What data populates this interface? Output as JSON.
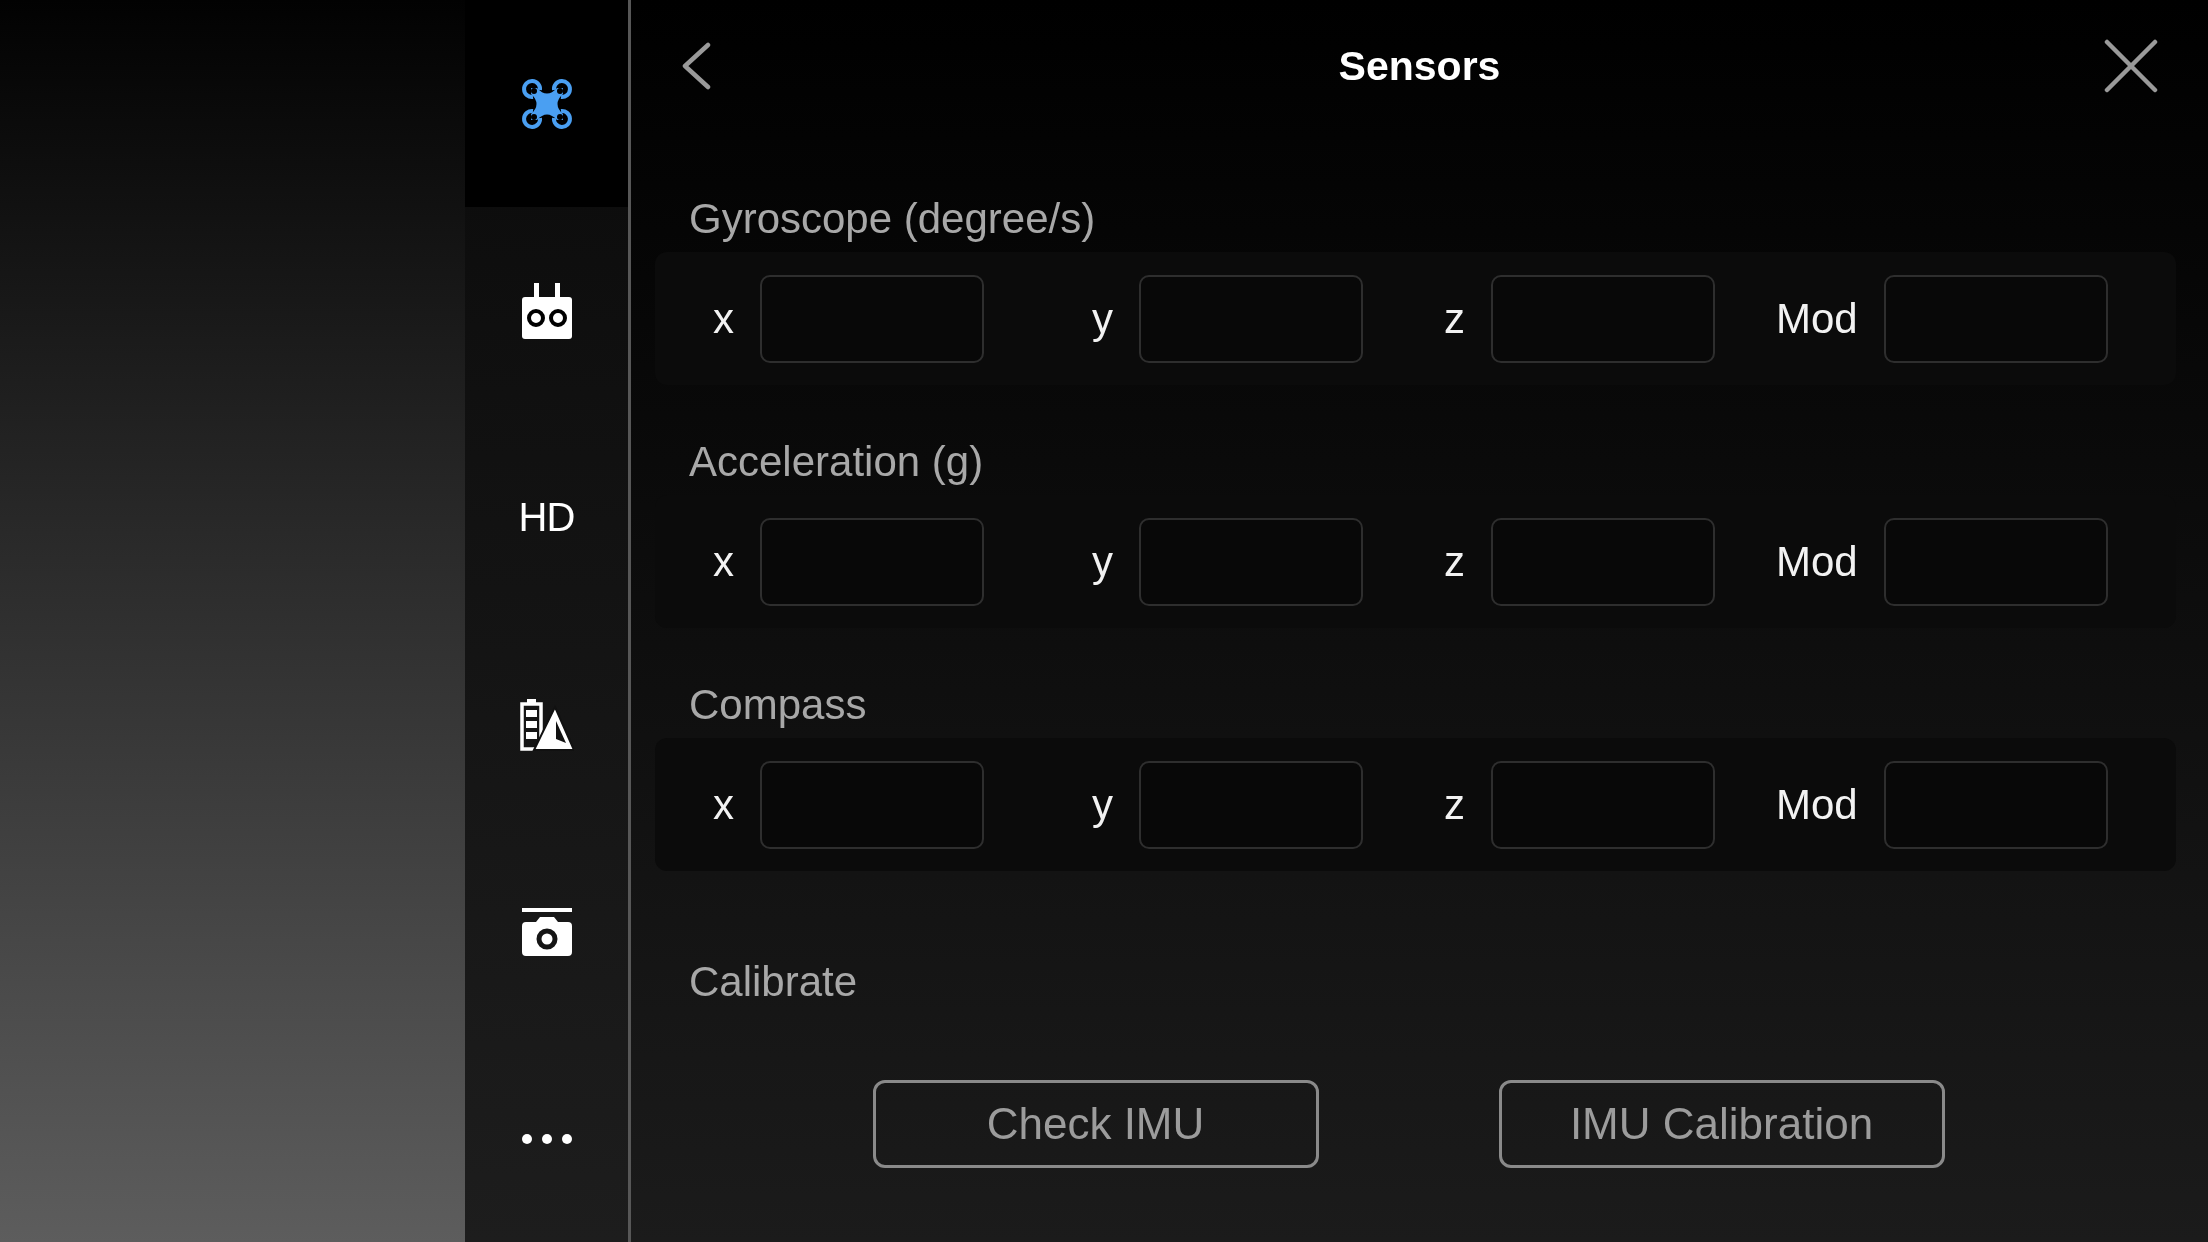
{
  "sidebar": {
    "items": [
      {
        "kind": "drone",
        "selected": true
      },
      {
        "kind": "remote",
        "selected": false
      },
      {
        "kind": "text",
        "label": "HD",
        "selected": false
      },
      {
        "kind": "battery-navigation",
        "selected": false
      },
      {
        "kind": "camera",
        "selected": false
      },
      {
        "kind": "more",
        "selected": false
      }
    ]
  },
  "header": {
    "title": "Sensors"
  },
  "sections": [
    {
      "title": "Gyroscope (degree/s)",
      "fields": [
        {
          "label": "x"
        },
        {
          "label": "y"
        },
        {
          "label": "z"
        },
        {
          "label": "Mod"
        }
      ]
    },
    {
      "title": "Acceleration (g)",
      "fields": [
        {
          "label": "x"
        },
        {
          "label": "y"
        },
        {
          "label": "z"
        },
        {
          "label": "Mod"
        }
      ]
    },
    {
      "title": "Compass",
      "fields": [
        {
          "label": "x"
        },
        {
          "label": "y"
        },
        {
          "label": "z"
        },
        {
          "label": "Mod"
        }
      ]
    }
  ],
  "calibrate": {
    "title": "Calibrate",
    "buttons": [
      {
        "label": "Check IMU"
      },
      {
        "label": "IMU Calibration"
      }
    ]
  }
}
